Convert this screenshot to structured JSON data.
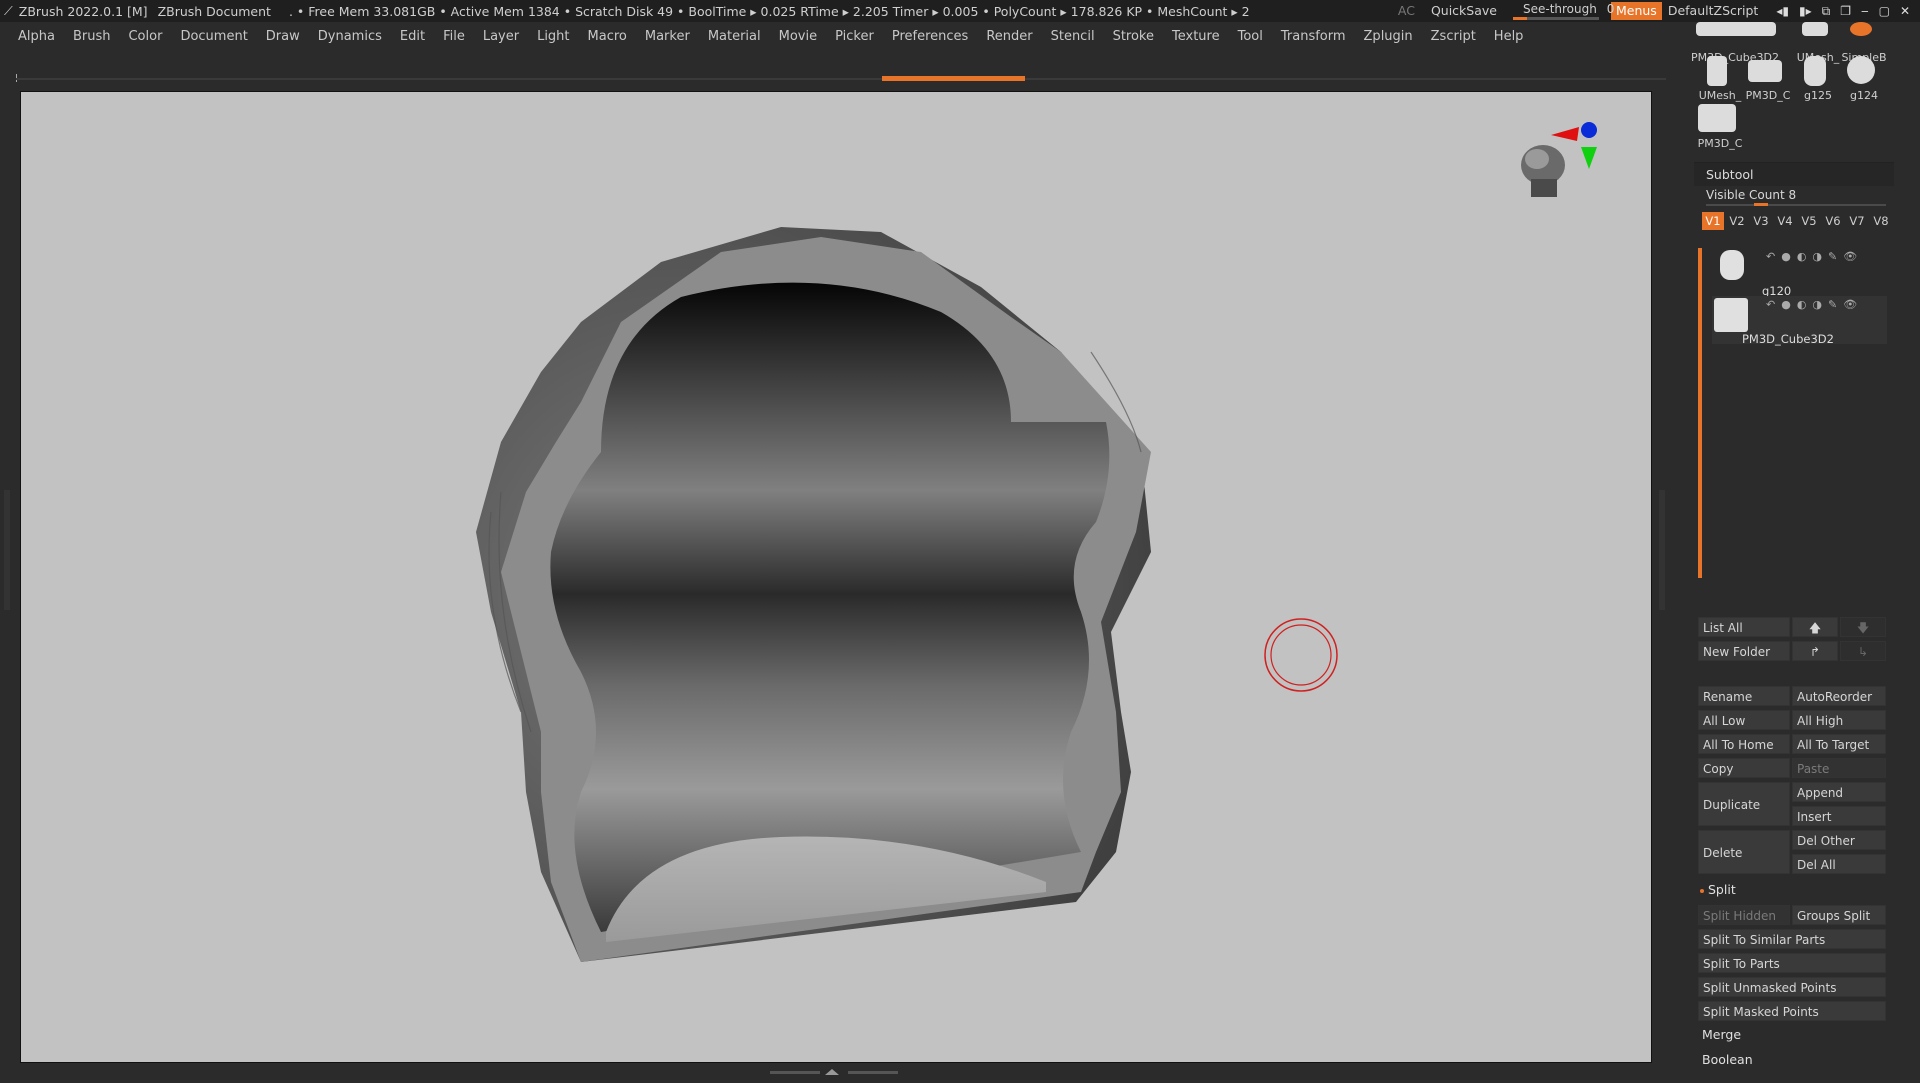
{
  "titlebar": {
    "app": "ZBrush 2022.0.1 [M]",
    "document": "ZBrush Document",
    "stats": ". • Free Mem 33.081GB • Active Mem 1384 • Scratch Disk 49 • BoolTime ▸ 0.025 RTime ▸ 2.205 Timer ▸ 0.005 • PolyCount ▸ 178.826 KP • MeshCount ▸ 2",
    "ac": "AC",
    "quicksave": "QuickSave",
    "see_through_label": "See-through",
    "see_through_value": "0",
    "menus": "Menus",
    "script": "DefaultZScript"
  },
  "menubar": [
    "Alpha",
    "Brush",
    "Color",
    "Document",
    "Draw",
    "Dynamics",
    "Edit",
    "File",
    "Layer",
    "Light",
    "Macro",
    "Marker",
    "Material",
    "Movie",
    "Picker",
    "Preferences",
    "Render",
    "Stencil",
    "Stroke",
    "Texture",
    "Tool",
    "Transform",
    "Zplugin",
    "Zscript",
    "Help"
  ],
  "tool_thumbs": [
    {
      "label": "PM3D_Cube3D2"
    },
    {
      "label": "UMesh_"
    },
    {
      "label": "SimpleB"
    },
    {
      "label": "UMesh_"
    },
    {
      "label": "PM3D_C"
    },
    {
      "label": "g125"
    },
    {
      "label": "g124"
    },
    {
      "label": "PM3D_C"
    }
  ],
  "subtool": {
    "title": "Subtool",
    "visible_count": "Visible Count 8",
    "tabs": [
      "V1",
      "V2",
      "V3",
      "V4",
      "V5",
      "V6",
      "V7",
      "V8"
    ],
    "active_tab": "V1",
    "items": [
      {
        "name": "g120"
      },
      {
        "name": "PM3D_Cube3D2"
      }
    ],
    "buttons": {
      "list_all": "List All",
      "new_folder": "New Folder",
      "rename": "Rename",
      "auto_reorder": "AutoReorder",
      "all_low": "All Low",
      "all_high": "All High",
      "all_to_home": "All To Home",
      "all_to_target": "All To Target",
      "copy": "Copy",
      "paste": "Paste",
      "duplicate": "Duplicate",
      "append": "Append",
      "insert": "Insert",
      "delete": "Delete",
      "del_other": "Del Other",
      "del_all": "Del All"
    },
    "split": {
      "title": "Split",
      "split_hidden": "Split Hidden",
      "groups_split": "Groups Split",
      "similar": "Split To Similar Parts",
      "parts": "Split To Parts",
      "unmasked": "Split Unmasked Points",
      "masked": "Split Masked Points"
    },
    "merge": "Merge",
    "boolean": "Boolean"
  },
  "colors": {
    "accent": "#e8742a",
    "viewport": "#c2c2c2"
  }
}
